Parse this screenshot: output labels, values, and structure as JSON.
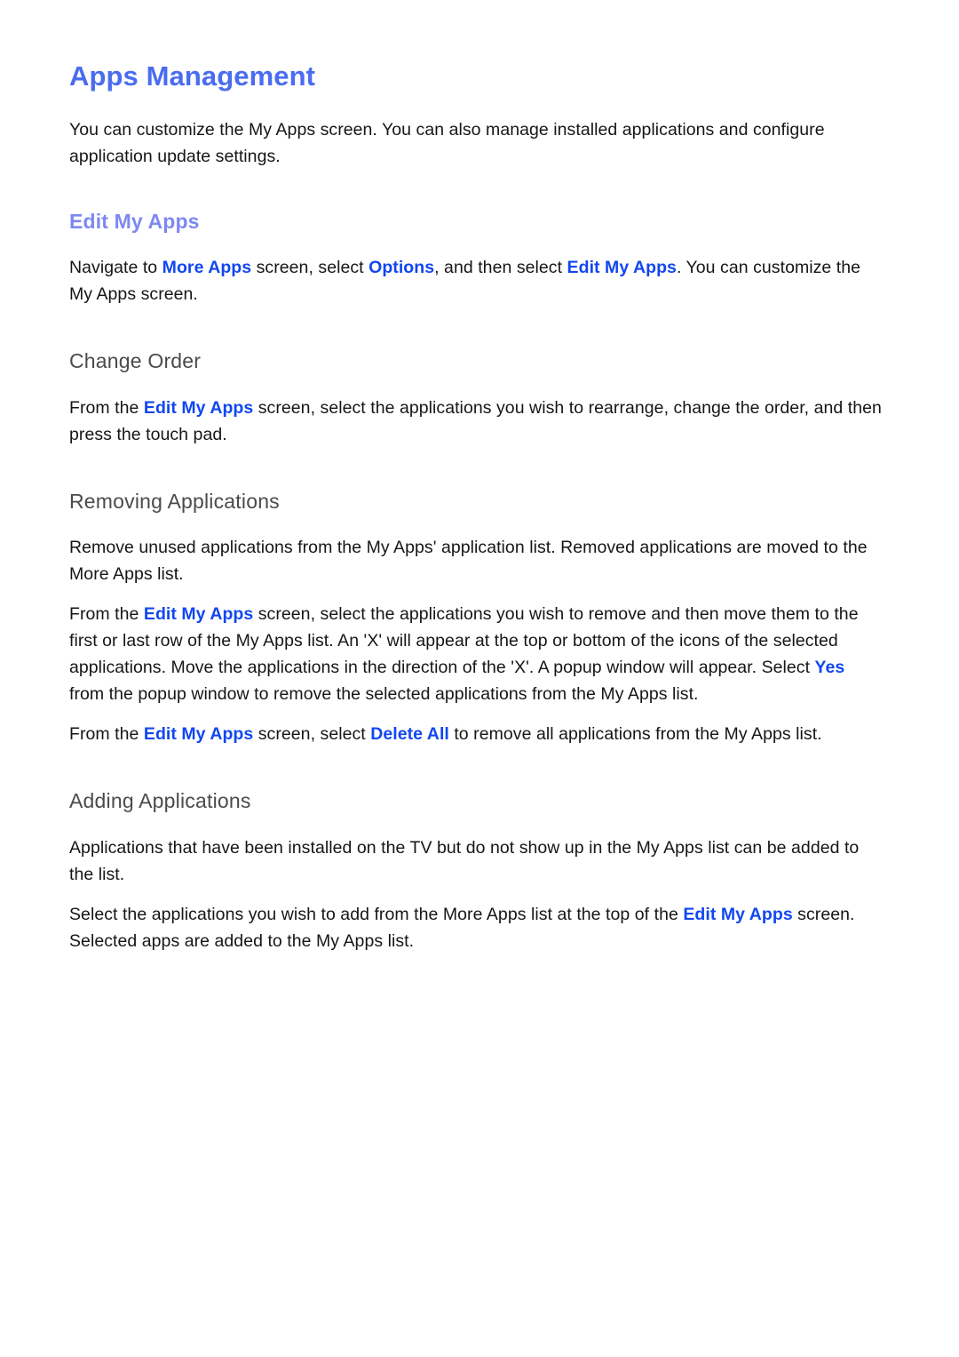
{
  "document": {
    "title": "Apps Management",
    "intro": "You can customize the My Apps screen. You can also manage installed applications and configure application update settings."
  },
  "colors": {
    "page_title": "#4a6cf0",
    "section_heading": "#7d88f2",
    "sub_heading": "#4b4b4b",
    "inline_link": "#1147f0",
    "body_text": "#161616",
    "background": "#ffffff"
  },
  "sections": [
    {
      "heading": "Edit My Apps",
      "paragraphs": [
        {
          "parts": [
            {
              "text": "Navigate to ",
              "link": false
            },
            {
              "text": "More Apps",
              "link": true
            },
            {
              "text": " screen, select ",
              "link": false
            },
            {
              "text": "Options",
              "link": true
            },
            {
              "text": ", and then select ",
              "link": false
            },
            {
              "text": "Edit My Apps",
              "link": true
            },
            {
              "text": ". You can customize the My Apps screen.",
              "link": false
            }
          ]
        }
      ],
      "subsections": [
        {
          "heading": "Change Order",
          "paragraphs": [
            {
              "parts": [
                {
                  "text": "From the ",
                  "link": false
                },
                {
                  "text": "Edit My Apps",
                  "link": true
                },
                {
                  "text": " screen, select the applications you wish to rearrange, change the order, and then press the touch pad.",
                  "link": false
                }
              ]
            }
          ]
        },
        {
          "heading": "Removing Applications",
          "paragraphs": [
            {
              "parts": [
                {
                  "text": "Remove unused applications from the My Apps' application list. Removed applications are moved to the More Apps list.",
                  "link": false
                }
              ]
            },
            {
              "parts": [
                {
                  "text": "From the ",
                  "link": false
                },
                {
                  "text": "Edit My Apps",
                  "link": true
                },
                {
                  "text": " screen, select the applications you wish to remove and then move them to the first or last row of the My Apps list. An 'X' will appear at the top or bottom of the icons of the selected applications. Move the applications in the direction of the 'X'. A popup window will appear. Select ",
                  "link": false
                },
                {
                  "text": "Yes",
                  "link": true
                },
                {
                  "text": " from the popup window to remove the selected applications from the My Apps list.",
                  "link": false
                }
              ]
            },
            {
              "parts": [
                {
                  "text": "From the ",
                  "link": false
                },
                {
                  "text": "Edit My Apps",
                  "link": true
                },
                {
                  "text": " screen, select ",
                  "link": false
                },
                {
                  "text": "Delete All",
                  "link": true
                },
                {
                  "text": " to remove all applications from the My Apps list.",
                  "link": false
                }
              ]
            }
          ]
        },
        {
          "heading": "Adding Applications",
          "paragraphs": [
            {
              "parts": [
                {
                  "text": "Applications that have been installed on the TV but do not show up in the My Apps list can be added to the list.",
                  "link": false
                }
              ]
            },
            {
              "parts": [
                {
                  "text": "Select the applications you wish to add from the More Apps list at the top of the ",
                  "link": false
                },
                {
                  "text": "Edit My Apps",
                  "link": true
                },
                {
                  "text": " screen. Selected apps are added to the My Apps list.",
                  "link": false
                }
              ]
            }
          ]
        }
      ]
    }
  ]
}
